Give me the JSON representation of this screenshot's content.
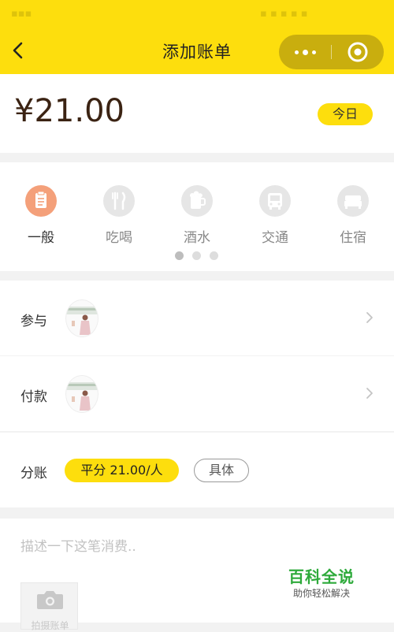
{
  "header": {
    "title": "添加账单",
    "back_icon": "chevron-left-icon",
    "menu_icon": "more-dots-icon",
    "close_icon": "target-icon",
    "background_color": "#fdde0d"
  },
  "amount": {
    "value": "¥21.00",
    "date_label": "今日"
  },
  "categories": {
    "items": [
      {
        "label": "一般",
        "icon": "notepad-icon",
        "active": true
      },
      {
        "label": "吃喝",
        "icon": "fork-knife-icon",
        "active": false
      },
      {
        "label": "酒水",
        "icon": "beer-mug-icon",
        "active": false
      },
      {
        "label": "交通",
        "icon": "bus-icon",
        "active": false
      },
      {
        "label": "住宿",
        "icon": "bed-icon",
        "active": false
      }
    ],
    "active_color": "#f4a07a",
    "page_count": 3,
    "current_page": 1
  },
  "participants": {
    "label": "参与"
  },
  "payer": {
    "label": "付款"
  },
  "split": {
    "label": "分账",
    "even_option": "平分 21.00/人",
    "detail_option": "具体"
  },
  "description": {
    "placeholder": "描述一下这笔消费..",
    "photo_label": "拍摄账单"
  },
  "watermark": {
    "title": "百科全说",
    "subtitle": "助你轻松解决"
  }
}
